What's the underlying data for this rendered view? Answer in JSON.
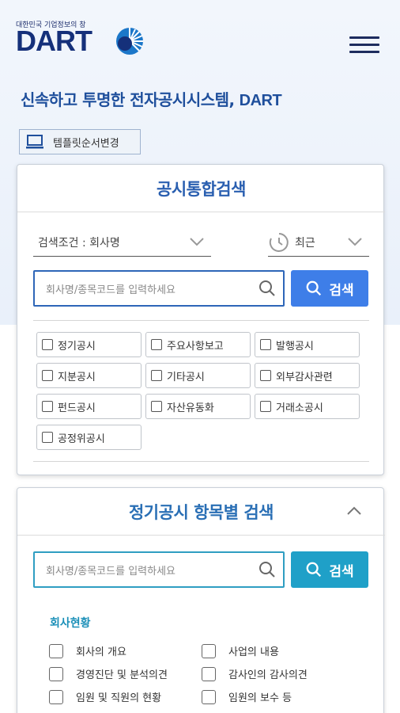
{
  "header": {
    "logo_sub": "대한민국 기업정보의 창",
    "logo_text": "DART"
  },
  "tagline": {
    "text": "신속하고 투명한 전자공시시스템,",
    "brand": "DART"
  },
  "template_button": {
    "label": "템플릿순서변경"
  },
  "integrated_search": {
    "title": "공시통합검색",
    "condition_select": "검색조건 : 회사명",
    "period_select": "최근",
    "search_placeholder": "회사명/종목코드를 입력하세요",
    "search_button": "검색",
    "categories": [
      "정기공시",
      "주요사항보고",
      "발행공시",
      "지분공시",
      "기타공시",
      "외부감사관련",
      "펀드공시",
      "자산유동화",
      "거래소공시",
      "공정위공시"
    ]
  },
  "periodic_search": {
    "title": "정기공시 항목별 검색",
    "search_placeholder": "회사명/종목코드를 입력하세요",
    "search_button": "검색",
    "section_title": "회사현황",
    "items": [
      "회사의 개요",
      "사업의 내용",
      "경영진단 및 분석의견",
      "감사인의 감사의견",
      "임원 및 직원의 현황",
      "임원의 보수 등"
    ]
  },
  "colors": {
    "primary_blue": "#3e7ee8",
    "teal": "#1fa0c8",
    "title_blue": "#2a5fb0",
    "navy": "#15307a"
  }
}
